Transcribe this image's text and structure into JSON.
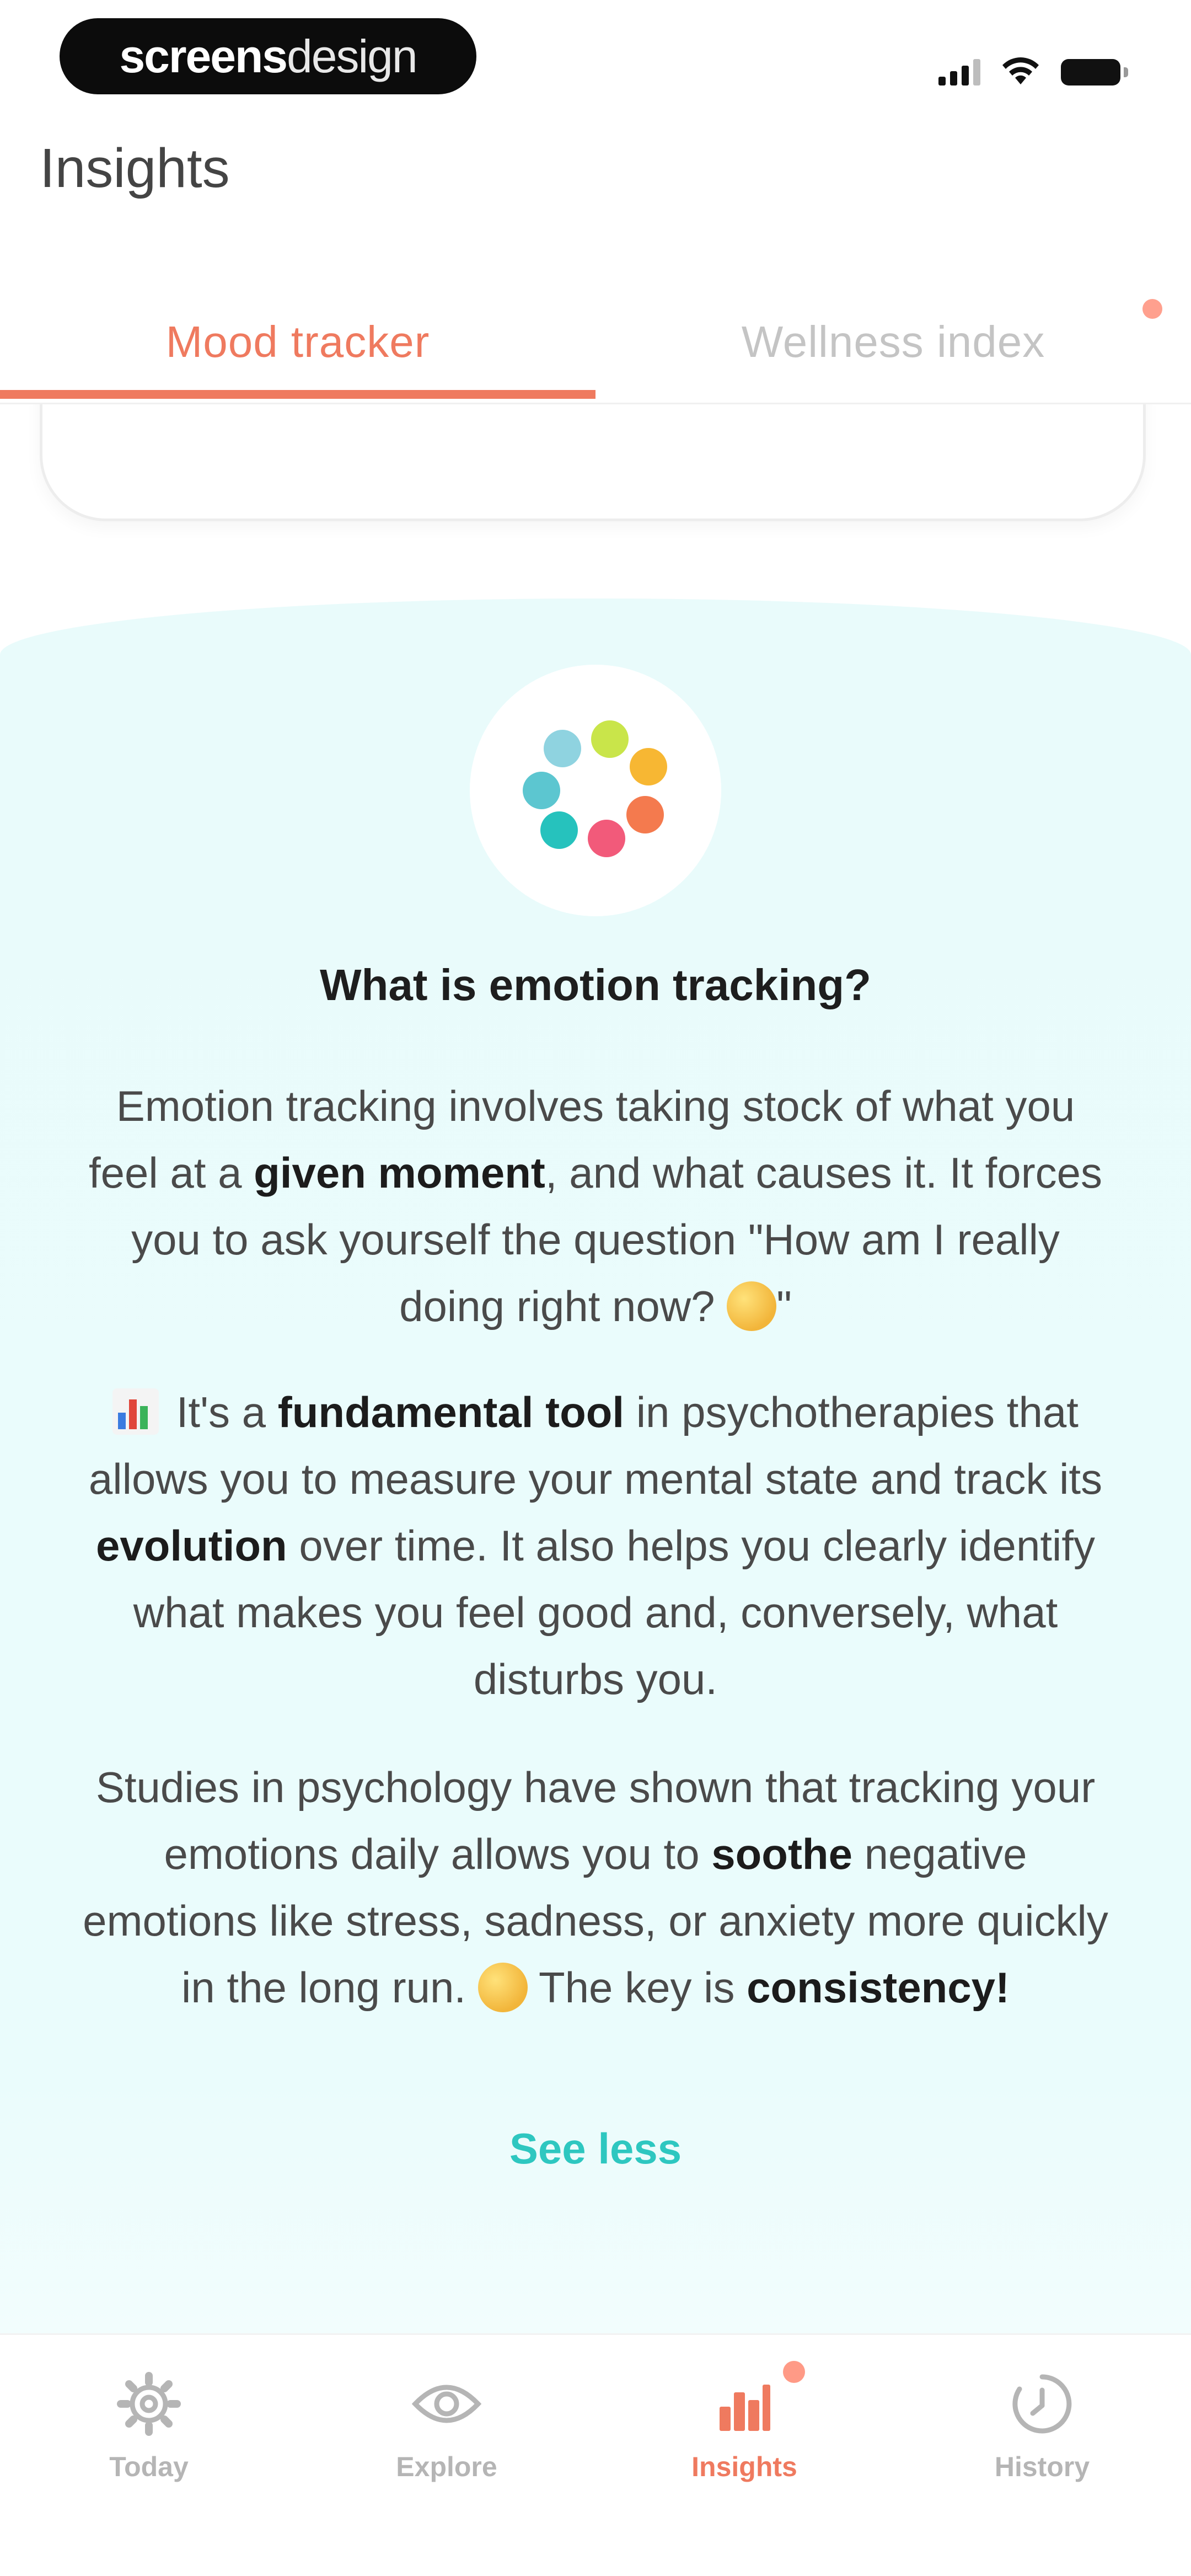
{
  "status_bar": {
    "brand_bold": "screens",
    "brand_light": "design"
  },
  "header": {
    "title": "Insights"
  },
  "tabs": [
    {
      "label": "Mood tracker",
      "active": true
    },
    {
      "label": "Wellness index",
      "active": false
    }
  ],
  "info": {
    "title": "What is emotion tracking?",
    "p1": {
      "a": "Emotion tracking involves taking stock of what you feel at a ",
      "b1": "given moment",
      "c": ", and what causes it. It forces you to ask yourself the question \"How am I really doing right now? ",
      "d": "\""
    },
    "p2": {
      "a": " It's a ",
      "b1": "fundamental tool",
      "c": " in psychotherapies that allows you to measure your mental state and track its ",
      "b2": "evolution",
      "d": " over time. It also helps you clearly identify what makes you feel good and, conversely, what disturbs you."
    },
    "p3": {
      "a": "Studies in psychology have shown that tracking your emotions daily allows you to ",
      "b1": "soothe",
      "c": " negative emotions like stress, sadness, or anxiety more quickly in the long run. ",
      "d": " The key is ",
      "b2": "consistency!"
    },
    "see_less": "See less"
  },
  "bottom_nav": [
    {
      "label": "Today",
      "icon": "gear-icon",
      "active": false
    },
    {
      "label": "Explore",
      "icon": "eye-icon",
      "active": false
    },
    {
      "label": "Insights",
      "icon": "bar-chart-icon",
      "active": true
    },
    {
      "label": "History",
      "icon": "history-clock-icon",
      "active": false
    }
  ],
  "colors": {
    "accent": "#ef7a5f",
    "teal_link": "#2ec7c0",
    "panel_bg": "#e9fbfb",
    "logo_dots": [
      "#c9e54a",
      "#f7b733",
      "#f47a4e",
      "#f25a7a",
      "#26c2bd",
      "#5cc6d0",
      "#8fd3e0"
    ]
  }
}
